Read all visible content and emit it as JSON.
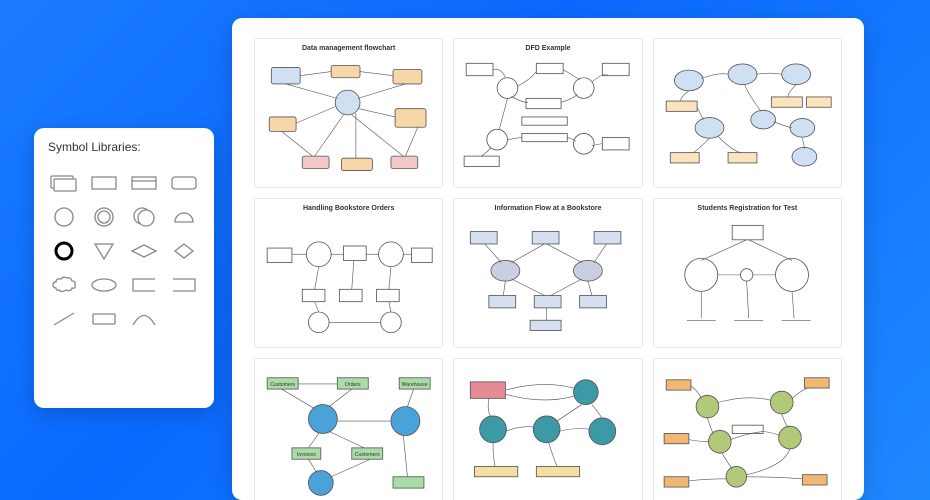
{
  "palette": {
    "title": "Symbol Libraries:"
  },
  "templates": {
    "t1": "Data management flowchart",
    "t2": "DFD Example",
    "t3": "",
    "t4": "Handling Bookstore Orders",
    "t5": "Information Flow at a Bookstore",
    "t6": "Students Registration for Test",
    "t7": "",
    "t8": "",
    "t9": ""
  },
  "nodes": {
    "t7_customers": "Customers",
    "t7_orders": "Orders",
    "t7_warehouse": "Warehouse",
    "t7_invoices": "Invoices",
    "t7_customers2": "Customers"
  }
}
